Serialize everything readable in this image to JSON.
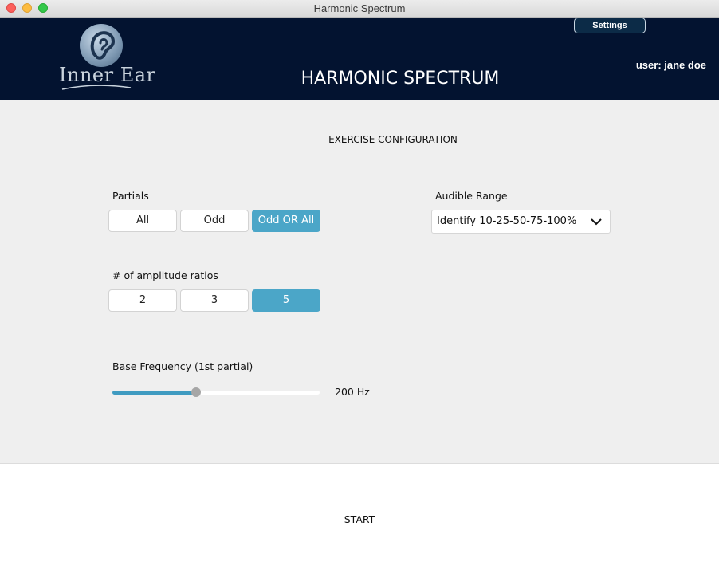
{
  "window": {
    "title": "Harmonic Spectrum"
  },
  "header": {
    "logo_text": "Inner Ear",
    "settings_label": "Settings",
    "user_label": "user: jane doe",
    "app_title": "HARMONIC SPECTRUM"
  },
  "config": {
    "heading": "EXERCISE CONFIGURATION",
    "partials": {
      "label": "Partials",
      "options": [
        "All",
        "Odd",
        "Odd OR All"
      ],
      "selected": "Odd OR All"
    },
    "amplitude_ratios": {
      "label": "# of amplitude ratios",
      "options": [
        "2",
        "3",
        "5"
      ],
      "selected": "5"
    },
    "audible_range": {
      "label": "Audible Range",
      "value": "Identify 10-25-50-75-100%"
    },
    "base_frequency": {
      "label": "Base Frequency (1st partial)",
      "value_text": "200 Hz",
      "level_fraction": 0.405
    }
  },
  "footer": {
    "start_label": "START"
  },
  "colors": {
    "header_bg": "#031330",
    "accent": "#4ba6c8",
    "panel_bg": "#efefef"
  },
  "icons": [
    "ear-logo-icon",
    "chevron-down-icon"
  ]
}
